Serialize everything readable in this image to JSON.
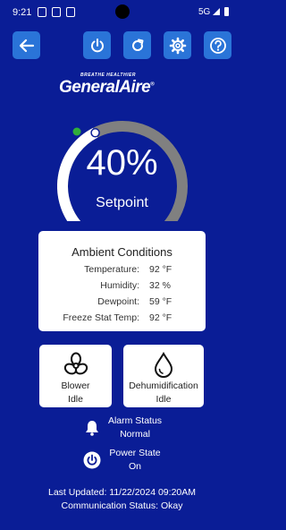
{
  "status_bar": {
    "time": "9:21",
    "network": "5G"
  },
  "toolbar": {
    "back_icon": "arrow-left-icon",
    "power_icon": "power-icon",
    "refresh_icon": "refresh-icon",
    "settings_icon": "gear-icon",
    "help_icon": "question-icon",
    "button_color": "#2a74d8"
  },
  "brand": {
    "tagline": "BREATHE HEALTHIER",
    "name": "GeneralAire",
    "registered": "®"
  },
  "gauge": {
    "value_text": "40%",
    "label": "Setpoint",
    "setpoint_fraction": 0.4,
    "track_color": "#808080",
    "fill_color": "#ffffff",
    "indicator_color": "#2fae3a"
  },
  "ambient": {
    "title": "Ambient Conditions",
    "rows": [
      {
        "label": "Temperature:",
        "value": "92 °F"
      },
      {
        "label": "Humidity:",
        "value": "32 %"
      },
      {
        "label": "Dewpoint:",
        "value": "59 °F"
      },
      {
        "label": "Freeze Stat Temp:",
        "value": "92 °F"
      }
    ]
  },
  "blower": {
    "icon": "fan-icon",
    "name": "Blower",
    "state": "Idle"
  },
  "dehumidification": {
    "icon": "water-drop-icon",
    "name": "Dehumidification",
    "state": "Idle"
  },
  "alarm": {
    "icon": "bell-icon",
    "label": "Alarm Status",
    "value": "Normal"
  },
  "power_state": {
    "icon": "power-icon",
    "label": "Power State",
    "value": "On"
  },
  "footer": {
    "last_updated": "Last Updated: 11/22/2024 09:20AM",
    "communication": "Communication Status: Okay"
  }
}
